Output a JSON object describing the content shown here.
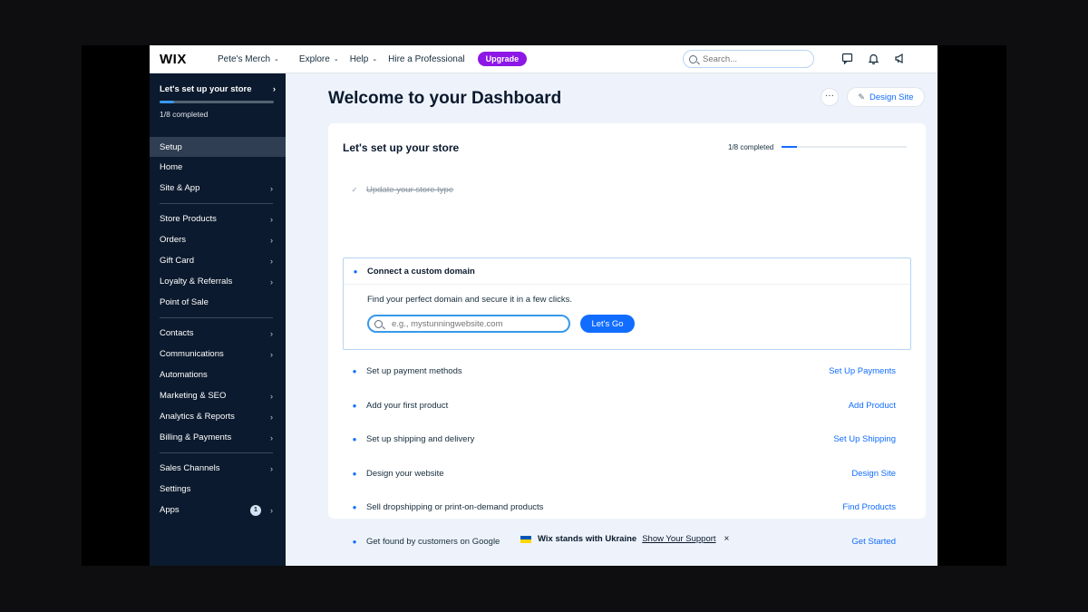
{
  "topbar": {
    "logo": "WIX",
    "site_name": "Pete's Merch",
    "nav": [
      "Explore",
      "Help"
    ],
    "hire": "Hire a Professional",
    "upgrade": "Upgrade",
    "search_placeholder": "Search..."
  },
  "sidebar": {
    "setup_title": "Let's set up your store",
    "setup_count": "1/8 completed",
    "progress_fraction": 0.125,
    "items": [
      {
        "label": "Setup",
        "active": true,
        "chevron": false
      },
      {
        "label": "Home",
        "chevron": false
      },
      {
        "label": "Site & App",
        "chevron": true
      },
      {
        "label": "Store Products",
        "chevron": true
      },
      {
        "label": "Orders",
        "chevron": true
      },
      {
        "label": "Gift Card",
        "chevron": true
      },
      {
        "label": "Loyalty & Referrals",
        "chevron": true
      },
      {
        "label": "Point of Sale",
        "chevron": false
      },
      {
        "label": "Contacts",
        "chevron": true
      },
      {
        "label": "Communications",
        "chevron": true
      },
      {
        "label": "Automations",
        "chevron": false
      },
      {
        "label": "Marketing & SEO",
        "chevron": true
      },
      {
        "label": "Analytics & Reports",
        "chevron": true
      },
      {
        "label": "Billing & Payments",
        "chevron": true
      },
      {
        "label": "Sales Channels",
        "chevron": true
      },
      {
        "label": "Settings",
        "chevron": false
      },
      {
        "label": "Apps",
        "chevron": true,
        "badge": "1"
      }
    ]
  },
  "main": {
    "title": "Welcome to your Dashboard",
    "dots": "···",
    "design_site": "Design Site",
    "card": {
      "title": "Let's set up your store",
      "count": "1/8 completed",
      "progress_fraction": 0.125,
      "done_task": "Update your store type",
      "expanded": {
        "title": "Connect a custom domain",
        "description": "Find your perfect domain and secure it in a few clicks.",
        "placeholder": "e.g., mystunningwebsite.com",
        "button": "Let's Go"
      },
      "tasks": [
        {
          "label": "Set up payment methods",
          "action": "Set Up Payments"
        },
        {
          "label": "Add your first product",
          "action": "Add Product"
        },
        {
          "label": "Set up shipping and delivery",
          "action": "Set Up Shipping"
        },
        {
          "label": "Design your website",
          "action": "Design Site"
        },
        {
          "label": "Sell dropshipping or print-on-demand products",
          "action": "Find Products"
        },
        {
          "label": "Get found by customers on Google",
          "action": "Get Started"
        }
      ]
    },
    "footer": {
      "text": "Wix stands with Ukraine",
      "link": "Show Your Support",
      "close": "×"
    }
  }
}
